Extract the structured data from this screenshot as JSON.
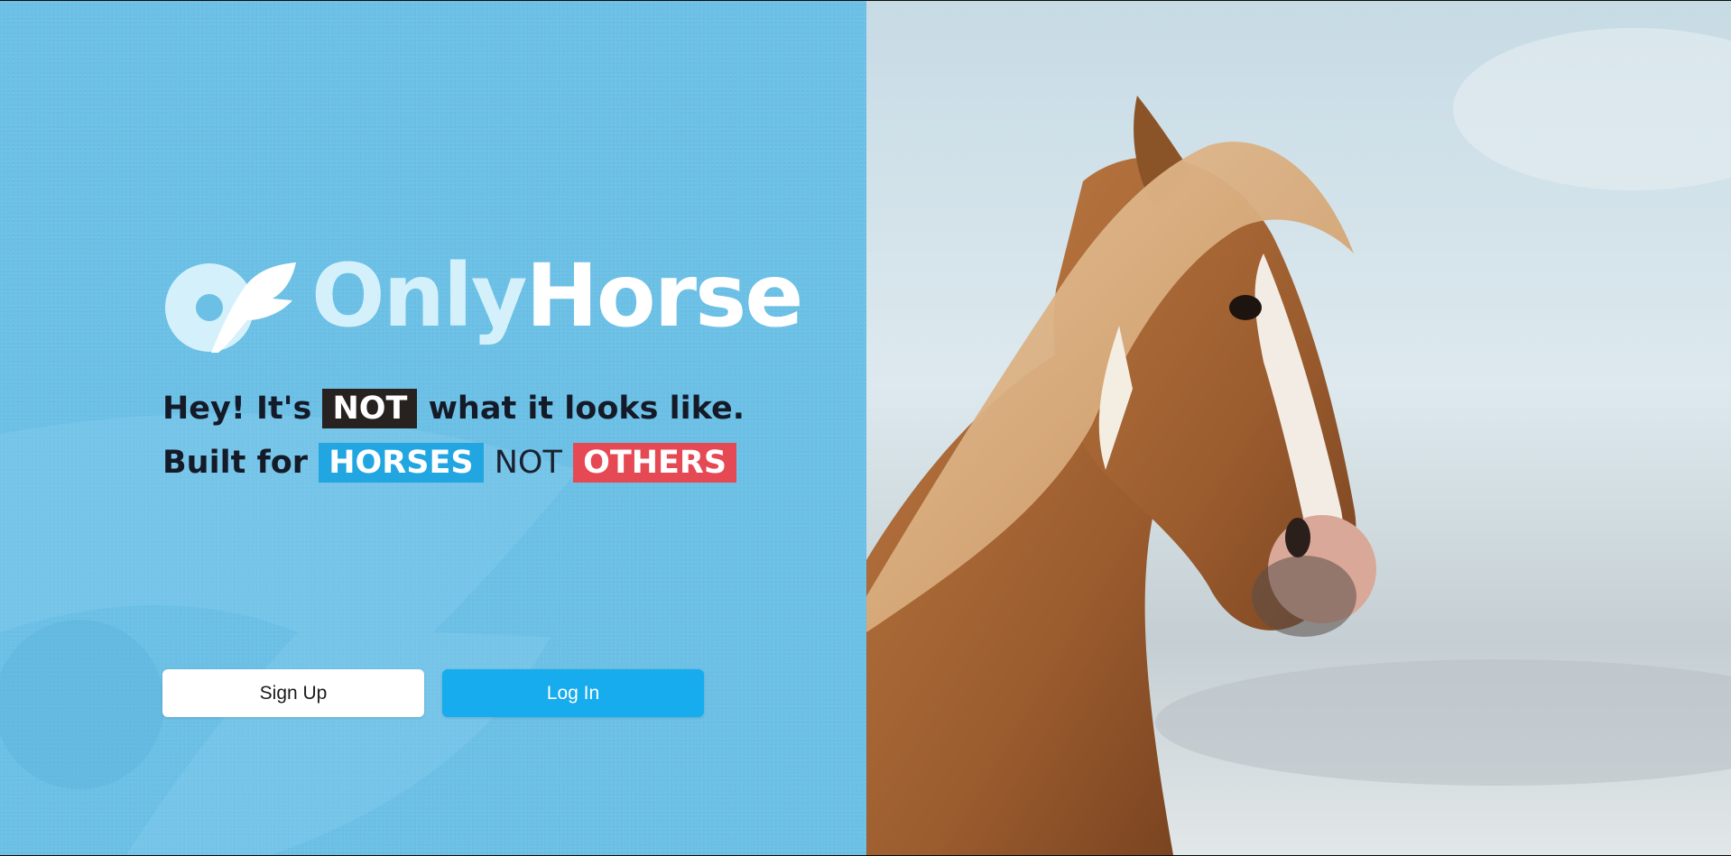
{
  "app": {
    "logo_light": "Only",
    "logo_bold": "Horse"
  },
  "tagline": {
    "line1_pre": "Hey! It's",
    "line1_highlight": "NOT",
    "line1_post": "what it looks like.",
    "line2_pre": "Built for",
    "line2_highlight1": "HORSES",
    "line2_mid": "NOT",
    "line2_highlight2": "OTHERS"
  },
  "buttons": {
    "signup_label": "Sign Up",
    "login_label": "Log In"
  },
  "colors": {
    "panel_bg": "#6cc0e6",
    "login_button": "#16acee",
    "highlight_not": "#27221f",
    "highlight_horses": "#22a6e2",
    "highlight_others": "#e54954"
  },
  "hero_image": {
    "icon": "horse-photo"
  }
}
